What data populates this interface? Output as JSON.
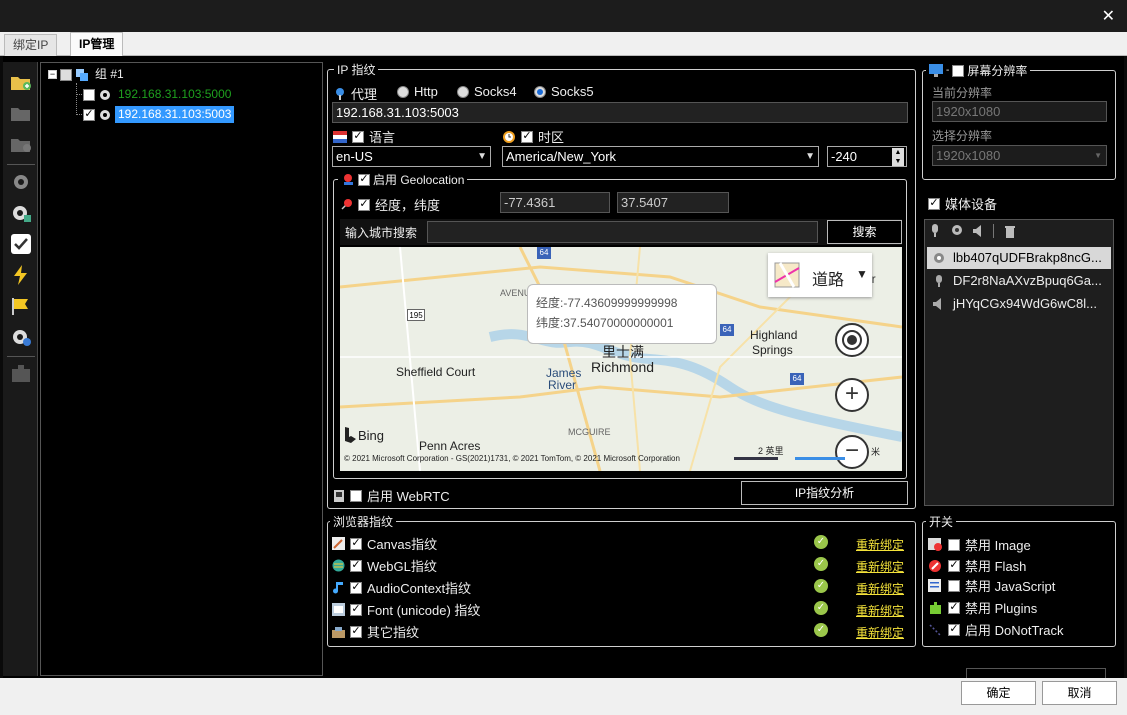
{
  "window": {
    "close_glyph": "✕"
  },
  "tabs": [
    {
      "label": "绑定IP"
    },
    {
      "label": "IP管理"
    }
  ],
  "tree": {
    "group_label": "组 #1",
    "items": [
      {
        "label": "192.168.31.103:5000",
        "color": "#1ea01e",
        "checked": false
      },
      {
        "label": "192.168.31.103:5003",
        "color": "#ffffff",
        "checked": true,
        "selected": true
      }
    ]
  },
  "ip_fingerprint": {
    "title": "IP 指纹",
    "proxy_label": "代理",
    "protocols": [
      {
        "label": "Http",
        "selected": false
      },
      {
        "label": "Socks4",
        "selected": false
      },
      {
        "label": "Socks5",
        "selected": true
      }
    ],
    "address": "192.168.31.103:5003",
    "language_label": "语言",
    "language_value": "en-US",
    "timezone_label": "时区",
    "timezone_value": "America/New_York",
    "timezone_offset": "-240"
  },
  "geolocation": {
    "title": "启用 Geolocation",
    "lnglat_label": "经度，纬度",
    "longitude": "-77.4361",
    "latitude": "37.5407",
    "search_label": "输入城市搜索",
    "search_placeholder": "",
    "search_button": "搜索",
    "map": {
      "style_label": "道路",
      "tooltip_lng": "经度:-77.43609999999998",
      "tooltip_lat": "纬度:37.54070000000001",
      "places": [
        "Highland",
        "Springs",
        "里士满",
        "Richmond",
        "Sheffield Court",
        "James",
        "River",
        "Penn Acres",
        "AVENUE",
        "MCGUIRE",
        "Bing"
      ],
      "route_shields": [
        "64",
        "195",
        "64",
        "64"
      ],
      "attribution": "© 2021 Microsoft Corporation - GS(2021)1731, © 2021 TomTom, © 2021 Microsoft Corporation",
      "scale_label": "2 英里",
      "partial_label": "or",
      "scale_right": "米"
    }
  },
  "webrtc": {
    "label": "启用 WebRTC",
    "analyze_button": "IP指纹分析"
  },
  "browser_fp": {
    "title": "浏览器指纹",
    "rebind_label": "重新绑定",
    "items": [
      {
        "label": "Canvas指纹"
      },
      {
        "label": "WebGL指纹"
      },
      {
        "label": "AudioContext指纹"
      },
      {
        "label": "Font (unicode) 指纹"
      },
      {
        "label": "其它指纹"
      }
    ]
  },
  "resolution": {
    "title": "屏幕分辨率",
    "current_label": "当前分辨率",
    "current_value": "1920x1080",
    "select_label": "选择分辨率",
    "select_value": "1920x1080"
  },
  "media": {
    "title": "媒体设备",
    "devices": [
      {
        "name": "lbb407qUDFBrakp8ncG...",
        "icon": "webcam-icon"
      },
      {
        "name": "DF2r8NaAXvzBpuq6Ga...",
        "icon": "mic-icon"
      },
      {
        "name": "jHYqCGx94WdG6wC8l...",
        "icon": "speaker-icon"
      }
    ]
  },
  "switches": {
    "title": "开关",
    "items": [
      {
        "label": "禁用 Image",
        "checked": false,
        "icon": "image-block-icon"
      },
      {
        "label": "禁用 Flash",
        "checked": true,
        "icon": "flash-block-icon"
      },
      {
        "label": "禁用 JavaScript",
        "checked": false,
        "icon": "script-icon"
      },
      {
        "label": "禁用 Plugins",
        "checked": true,
        "icon": "plugin-icon"
      },
      {
        "label": "启用 DoNotTrack",
        "checked": true,
        "icon": "dnt-icon"
      }
    ]
  },
  "footer": {
    "ok_label": "确定",
    "cancel_label": "取消"
  }
}
